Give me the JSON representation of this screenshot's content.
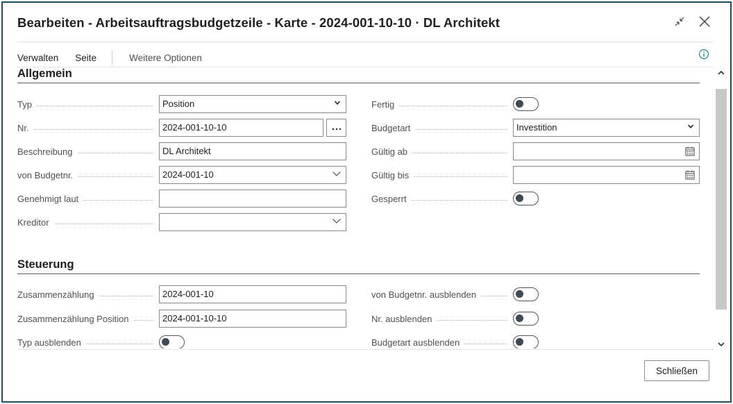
{
  "window": {
    "title": "Bearbeiten - Arbeitsauftragsbudgetzeile - Karte - 2024-001-10-10 · DL Architekt"
  },
  "actions": {
    "manage": "Verwalten",
    "page": "Seite",
    "more": "Weitere Optionen"
  },
  "general": {
    "title": "Allgemein",
    "typ_label": "Typ",
    "typ_value": "Position",
    "nr_label": "Nr.",
    "nr_value": "2024-001-10-10",
    "beschreibung_label": "Beschreibung",
    "beschreibung_value": "DL Architekt",
    "von_budgetnr_label": "von Budgetnr.",
    "von_budgetnr_value": "2024-001-10",
    "genehmigt_label": "Genehmigt laut",
    "genehmigt_value": "",
    "kreditor_label": "Kreditor",
    "kreditor_value": "",
    "fertig_label": "Fertig",
    "fertig_on": false,
    "budgetart_label": "Budgetart",
    "budgetart_value": "Investition",
    "gueltig_ab_label": "Gültig ab",
    "gueltig_ab_value": "",
    "gueltig_bis_label": "Gültig bis",
    "gueltig_bis_value": "",
    "gesperrt_label": "Gesperrt",
    "gesperrt_on": false
  },
  "control": {
    "title": "Steuerung",
    "zusammenzaehlung_label": "Zusammenzählung",
    "zusammenzaehlung_value": "2024-001-10",
    "zusammenzaehlung_pos_label": "Zusammenzählung Position",
    "zusammenzaehlung_pos_value": "2024-001-10-10",
    "typ_ausblenden_label": "Typ ausblenden",
    "typ_ausblenden_on": false,
    "von_budgetnr_ausblenden_label": "von Budgetnr. ausblenden",
    "von_budgetnr_ausblenden_on": false,
    "nr_ausblenden_label": "Nr. ausblenden",
    "nr_ausblenden_on": false,
    "budgetart_ausblenden_label": "Budgetart ausblenden",
    "budgetart_ausblenden_on": false
  },
  "footer": {
    "close_label": "Schließen"
  },
  "icons": {
    "collapse": "collapse-icon",
    "close": "close-icon",
    "info": "info-icon",
    "chevron": "chevron-down-icon",
    "calendar": "calendar-icon",
    "ellipsis": "ellipsis-icon"
  },
  "colors": {
    "border": "#1d4f63",
    "info": "#1a8a8a",
    "toggle": "#3f4a57"
  }
}
